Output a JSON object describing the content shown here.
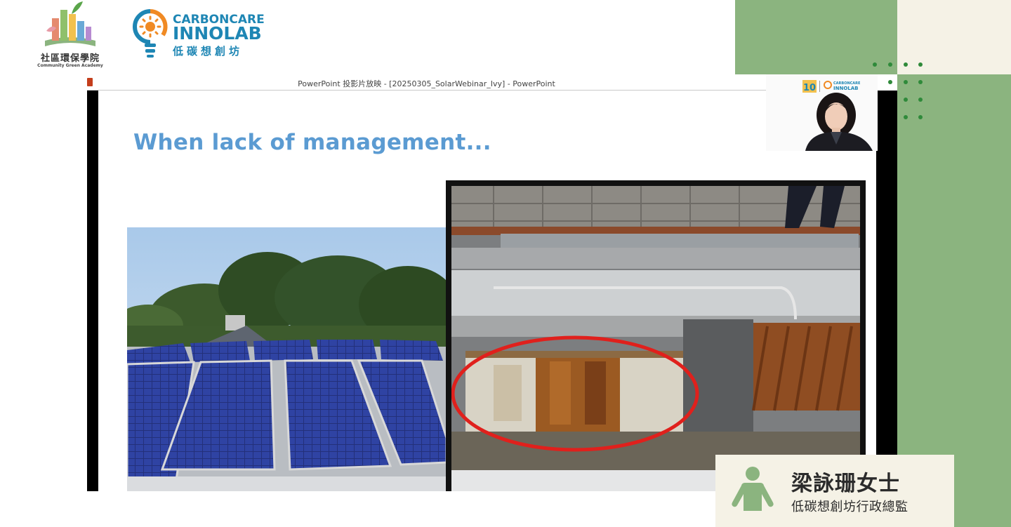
{
  "branding": {
    "academy_name_zh": "社區環保學院",
    "academy_name_en": "Community Green Academy",
    "innolab_line1": "CARBONCARE",
    "innolab_line2_a": "INNO",
    "innolab_line2_b": "LAB",
    "innolab_name_zh": "低碳想創坊"
  },
  "window": {
    "title": "PowerPoint 投影片放映 - [20250305_SolarWebinar_Ivy] - PowerPoint"
  },
  "slide": {
    "heading": "When lack of management..."
  },
  "webcam": {
    "logo_number": "10",
    "logo_text": "CARBONCARE INNOLAB"
  },
  "speaker": {
    "name": "梁詠珊女士",
    "title": "低碳想創坊行政總監"
  },
  "colors": {
    "accent_green": "#8bb47f",
    "cream": "#f5f2e6",
    "heading_blue": "#5b9bd2",
    "dot_green": "#2f8a3a",
    "highlight_red": "#e0201c"
  }
}
